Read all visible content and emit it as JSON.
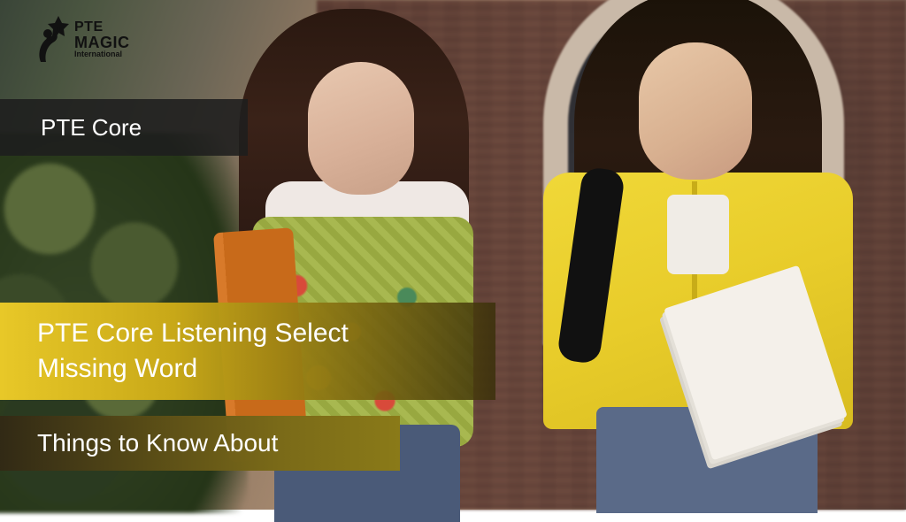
{
  "logo": {
    "line1": "PTE",
    "line2": "MAGIC",
    "line3": "International"
  },
  "overlays": {
    "category": "PTE Core",
    "title_line1": "PTE Core Listening Select",
    "title_line2": "Missing Word",
    "subtitle": "Things to Know About"
  }
}
